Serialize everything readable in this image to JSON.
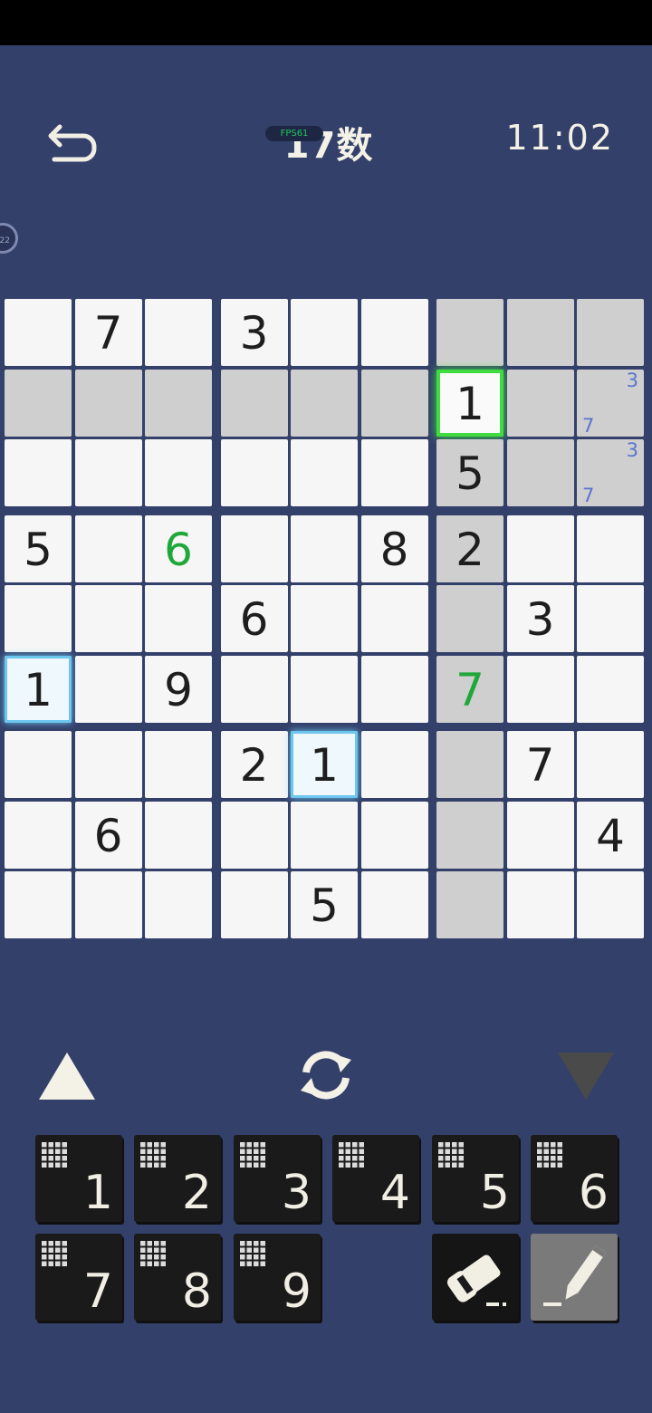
{
  "header": {
    "title": "17数",
    "fps_label": "FPS61",
    "timer": "11:02",
    "side_badge": "22"
  },
  "board": {
    "cells": [
      [
        "",
        "7",
        "",
        "3",
        "",
        "",
        "",
        "",
        ""
      ],
      [
        "",
        "",
        "",
        "",
        "",
        "",
        "1",
        "",
        ""
      ],
      [
        "",
        "",
        "",
        "",
        "",
        "",
        "5",
        "",
        ""
      ],
      [
        "5",
        "",
        "6",
        "",
        "",
        "8",
        "2",
        "",
        ""
      ],
      [
        "",
        "",
        "",
        "6",
        "",
        "",
        "",
        "3",
        ""
      ],
      [
        "1",
        "",
        "9",
        "",
        "",
        "",
        "7",
        "",
        ""
      ],
      [
        "",
        "",
        "",
        "2",
        "1",
        "",
        "",
        "7",
        ""
      ],
      [
        "",
        "6",
        "",
        "",
        "",
        "",
        "",
        "",
        "4"
      ],
      [
        "",
        "",
        "",
        "",
        "5",
        "",
        "",
        "",
        ""
      ]
    ],
    "green_digits": [
      [
        3,
        2
      ],
      [
        5,
        6
      ]
    ],
    "highlighted_cells": [
      [
        0,
        6
      ],
      [
        0,
        7
      ],
      [
        0,
        8
      ],
      [
        1,
        0
      ],
      [
        1,
        1
      ],
      [
        1,
        2
      ],
      [
        1,
        3
      ],
      [
        1,
        4
      ],
      [
        1,
        5
      ],
      [
        1,
        7
      ],
      [
        1,
        8
      ],
      [
        2,
        6
      ],
      [
        2,
        7
      ],
      [
        2,
        8
      ],
      [
        3,
        6
      ],
      [
        4,
        6
      ],
      [
        5,
        6
      ],
      [
        6,
        6
      ],
      [
        7,
        6
      ],
      [
        8,
        6
      ]
    ],
    "selected_cell": [
      1,
      6
    ],
    "same_value_cells": [
      [
        5,
        0
      ],
      [
        6,
        4
      ]
    ],
    "notes": [
      {
        "cell": [
          1,
          8
        ],
        "top_right": "3",
        "bottom_left": "7"
      },
      {
        "cell": [
          2,
          8
        ],
        "top_right": "3",
        "bottom_left": "7"
      }
    ],
    "colors": {
      "background": "#33406a",
      "cell": "#f6f6f6",
      "highlight": "#cfcfcf",
      "selected_border": "#3fdc3f",
      "same_value_border": "#6cc6ee",
      "green_digit": "#1fa83a",
      "note": "#5a74d0"
    }
  },
  "controls": {
    "up_icon": "triangle-up-icon",
    "refresh_icon": "refresh-icon",
    "down_icon": "triangle-down-icon"
  },
  "keypad": {
    "digits": [
      "1",
      "2",
      "3",
      "4",
      "5",
      "6",
      "7",
      "8",
      "9"
    ],
    "erase_icon": "eraser-icon",
    "pencil_icon": "pencil-icon"
  }
}
